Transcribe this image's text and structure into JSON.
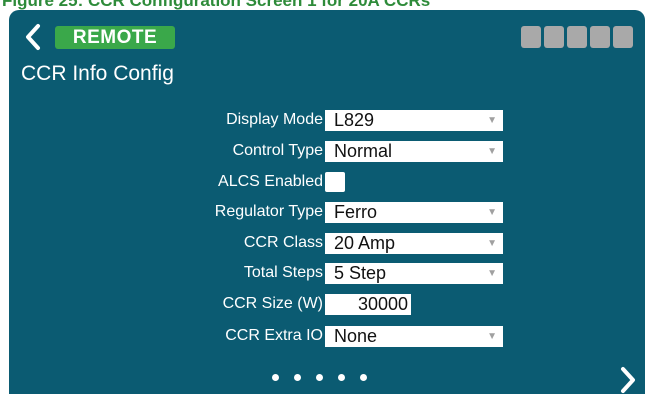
{
  "caption": "Figure 25: CCR Configuration Screen 1 for 20A CCRs",
  "header": {
    "remote_badge": "REMOTE",
    "title": "CCR Info Config"
  },
  "fields": {
    "display_mode": {
      "label": "Display Mode",
      "value": "L829"
    },
    "control_type": {
      "label": "Control Type",
      "value": "Normal"
    },
    "alcs_enabled": {
      "label": "ALCS Enabled",
      "checked": false
    },
    "regulator_type": {
      "label": "Regulator Type",
      "value": "Ferro"
    },
    "ccr_class": {
      "label": "CCR Class",
      "value": "20 Amp"
    },
    "total_steps": {
      "label": "Total Steps",
      "value": "5 Step"
    },
    "ccr_size": {
      "label": "CCR Size (W)",
      "value": "30000"
    },
    "ccr_extra_io": {
      "label": "CCR Extra IO",
      "value": "None"
    }
  },
  "pagination": {
    "page_count": 5,
    "current_page": 1
  },
  "icons": {
    "back": "chevron-left-icon",
    "next": "chevron-right-icon",
    "dropdown": "triangle-down-icon"
  },
  "colors": {
    "panel": "#0b5b72",
    "badge": "#3aa84a",
    "caption": "#2e8b3a",
    "status_blocks": "#a9a9a9"
  }
}
